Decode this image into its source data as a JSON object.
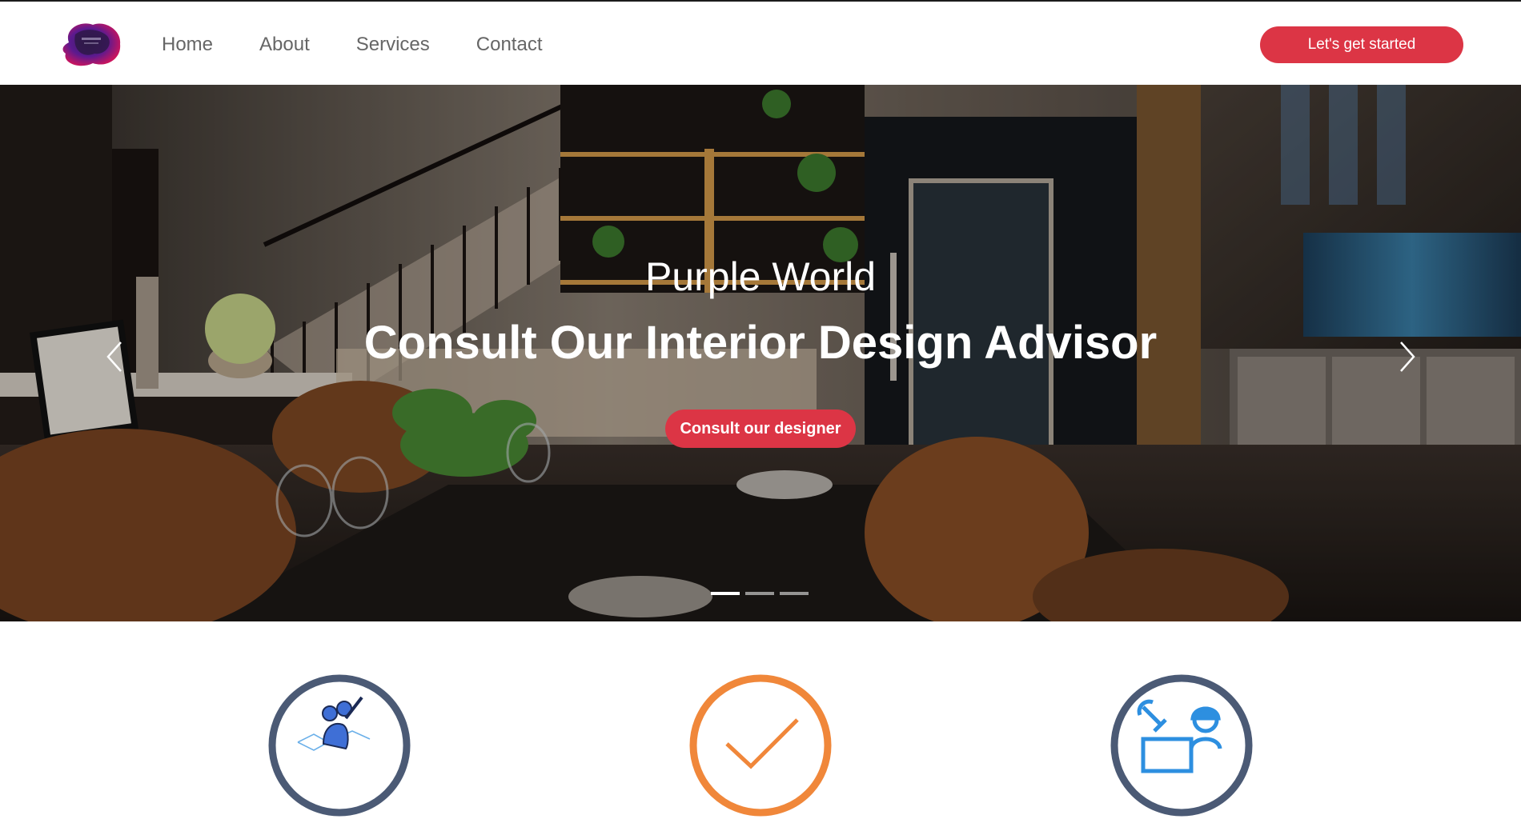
{
  "navbar": {
    "logo_icon": "purple-blob-logo",
    "links": [
      {
        "label": "Home"
      },
      {
        "label": "About"
      },
      {
        "label": "Services"
      },
      {
        "label": "Contact"
      }
    ],
    "cta_label": "Let's get started"
  },
  "hero": {
    "eyebrow": "Purple World",
    "title": "Consult Our Interior Design Advisor",
    "cta_label": "Consult our designer",
    "prev_icon": "chevron-left-icon",
    "next_icon": "chevron-right-icon",
    "slides_count": 3,
    "active_slide": 1
  },
  "features": [
    {
      "icon": "designer-drawing-icon",
      "ring_color": "#4b5a75"
    },
    {
      "icon": "checkmark-icon",
      "ring_color": "#f0873a"
    },
    {
      "icon": "engineer-tools-icon",
      "ring_color": "#4b5a75"
    }
  ],
  "colors": {
    "accent": "#dc3545",
    "nav_text": "#666666",
    "ring_dark": "#4b5a75",
    "ring_orange": "#f0873a",
    "icon_blue": "#2d8fe0"
  }
}
